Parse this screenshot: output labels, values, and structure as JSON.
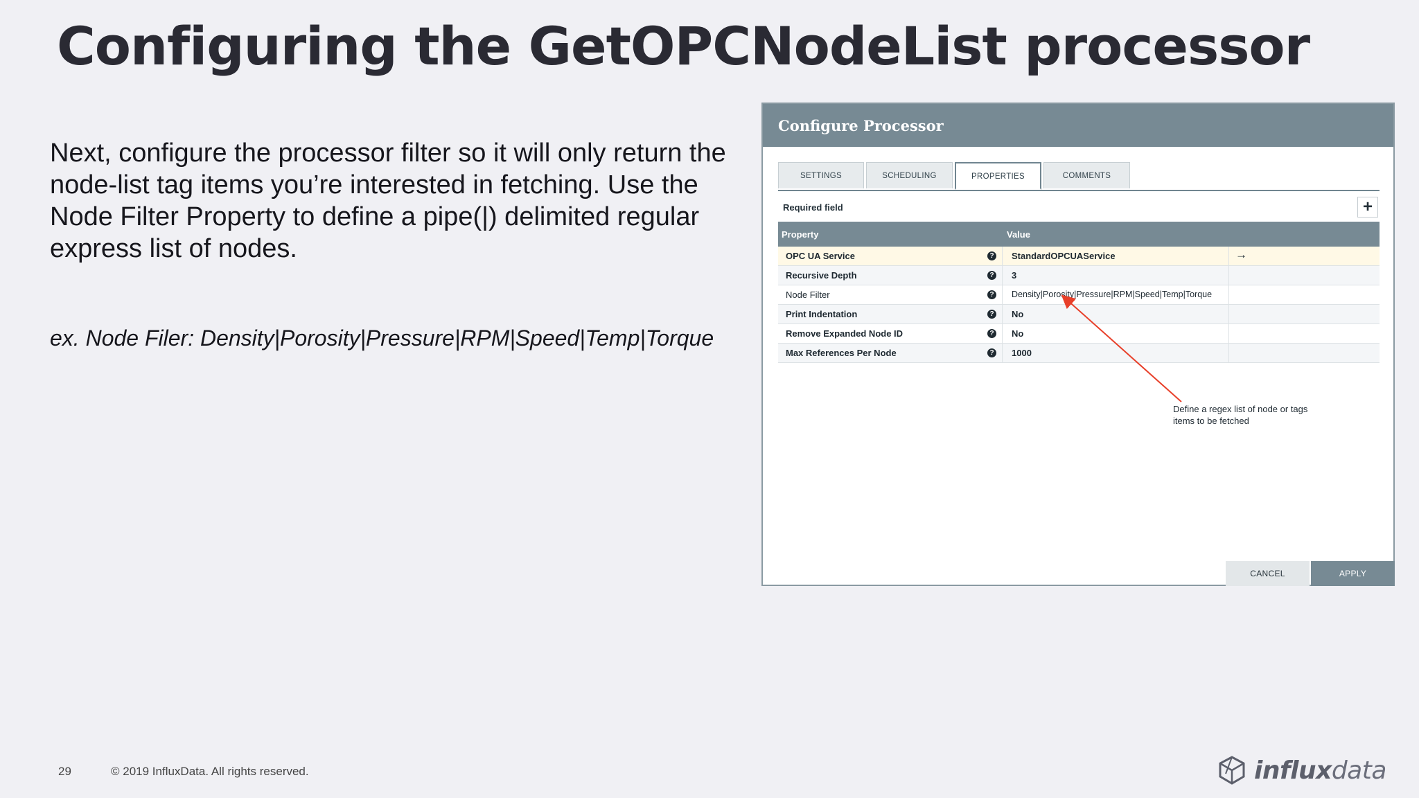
{
  "slide": {
    "title": "Configuring the GetOPCNodeList processor",
    "body": "Next, configure the processor filter so it will only return the node-list tag items you’re interested in fetching. Use the Node Filter Property to define a pipe(|) delimited regular express list of nodes.",
    "example": "ex. Node Filer: Density|Porosity|Pressure|RPM|Speed|Temp|Torque",
    "page_number": "29",
    "copyright": "© 2019 InfluxData. All rights reserved.",
    "logo": {
      "brand_bold": "influx",
      "brand_light": "data",
      "icon": "influxdata-cube-icon"
    }
  },
  "dialog": {
    "title": "Configure Processor",
    "tabs": [
      {
        "label": "SETTINGS"
      },
      {
        "label": "SCHEDULING"
      },
      {
        "label": "PROPERTIES",
        "active": true
      },
      {
        "label": "COMMENTS"
      }
    ],
    "required_label": "Required field",
    "add_label": "+",
    "table": {
      "headers": {
        "property": "Property",
        "value": "Value"
      },
      "rows": [
        {
          "name": "OPC UA Service",
          "value": "StandardOPCUAService"
        },
        {
          "name": "Recursive Depth",
          "value": "3"
        },
        {
          "name": "Node Filter",
          "value": "Density|Porosity|Pressure|RPM|Speed|Temp|Torque"
        },
        {
          "name": "Print Indentation",
          "value": "No"
        },
        {
          "name": "Remove Expanded Node ID",
          "value": "No"
        },
        {
          "name": "Max References Per Node",
          "value": "1000"
        }
      ]
    },
    "help_glyph": "?",
    "goto_glyph": "→",
    "annotation": "Define a regex list of node or tags items to be fetched",
    "annotation_color": "#e8402a",
    "buttons": {
      "cancel": "CANCEL",
      "apply": "APPLY"
    }
  }
}
